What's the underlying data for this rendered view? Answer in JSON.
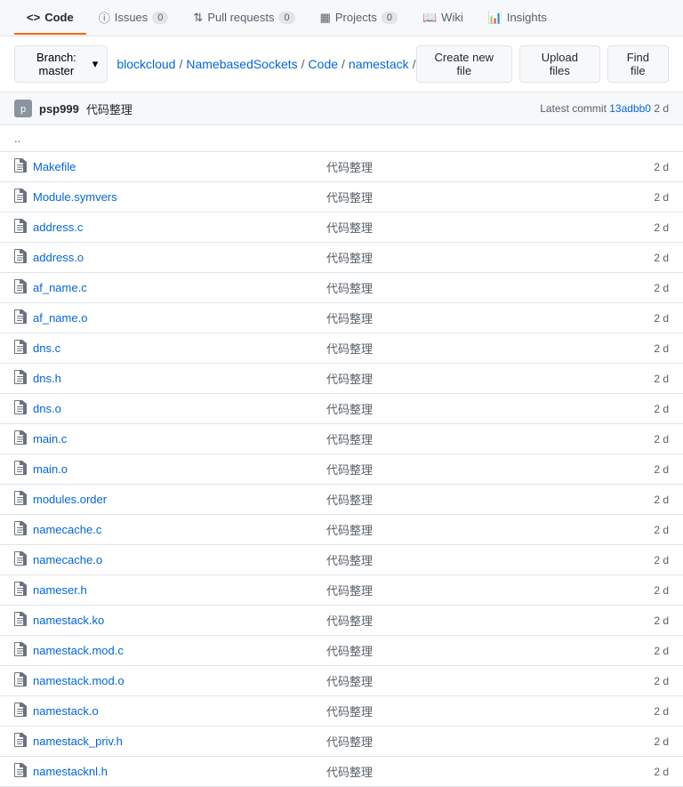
{
  "nav": {
    "tabs": [
      {
        "id": "code",
        "label": "Code",
        "icon": "<>",
        "badge": null,
        "active": true
      },
      {
        "id": "issues",
        "label": "Issues",
        "icon": "!",
        "badge": "0",
        "active": false
      },
      {
        "id": "pull-requests",
        "label": "Pull requests",
        "icon": "↕",
        "badge": "0",
        "active": false
      },
      {
        "id": "projects",
        "label": "Projects",
        "icon": "▦",
        "badge": "0",
        "active": false
      },
      {
        "id": "wiki",
        "label": "Wiki",
        "icon": "📖",
        "badge": null,
        "active": false
      },
      {
        "id": "insights",
        "label": "Insights",
        "icon": "📊",
        "badge": null,
        "active": false
      }
    ]
  },
  "toolbar": {
    "branch_label": "Branch: master",
    "branch_caret": "▾",
    "breadcrumb": [
      {
        "text": "blockcloud",
        "href": "#"
      },
      {
        "sep": "/"
      },
      {
        "text": "NamebasedSockets",
        "href": "#"
      },
      {
        "sep": "/"
      },
      {
        "text": "Code",
        "href": "#"
      },
      {
        "sep": "/"
      },
      {
        "text": "namestack",
        "href": "#"
      },
      {
        "sep": "/"
      }
    ],
    "buttons": [
      {
        "id": "create-new-file",
        "label": "Create new file"
      },
      {
        "id": "upload-files",
        "label": "Upload files"
      },
      {
        "id": "find-file",
        "label": "Find file"
      }
    ]
  },
  "commit_header": {
    "avatar_text": "p",
    "username": "psp999",
    "commit_message": "代码整理",
    "latest_commit_label": "Latest commit",
    "commit_hash": "13adbb0",
    "commit_time": "2 d"
  },
  "files": [
    {
      "name": "..",
      "type": "parent",
      "message": "",
      "time": ""
    },
    {
      "name": "Makefile",
      "type": "file",
      "message": "代码整理",
      "time": "2 d"
    },
    {
      "name": "Module.symvers",
      "type": "file",
      "message": "代码整理",
      "time": "2 d"
    },
    {
      "name": "address.c",
      "type": "file",
      "message": "代码整理",
      "time": "2 d"
    },
    {
      "name": "address.o",
      "type": "file",
      "message": "代码整理",
      "time": "2 d"
    },
    {
      "name": "af_name.c",
      "type": "file",
      "message": "代码整理",
      "time": "2 d"
    },
    {
      "name": "af_name.o",
      "type": "file",
      "message": "代码整理",
      "time": "2 d"
    },
    {
      "name": "dns.c",
      "type": "file",
      "message": "代码整理",
      "time": "2 d"
    },
    {
      "name": "dns.h",
      "type": "file",
      "message": "代码整理",
      "time": "2 d"
    },
    {
      "name": "dns.o",
      "type": "file",
      "message": "代码整理",
      "time": "2 d"
    },
    {
      "name": "main.c",
      "type": "file",
      "message": "代码整理",
      "time": "2 d"
    },
    {
      "name": "main.o",
      "type": "file",
      "message": "代码整理",
      "time": "2 d"
    },
    {
      "name": "modules.order",
      "type": "file",
      "message": "代码整理",
      "time": "2 d"
    },
    {
      "name": "namecache.c",
      "type": "file",
      "message": "代码整理",
      "time": "2 d"
    },
    {
      "name": "namecache.o",
      "type": "file",
      "message": "代码整理",
      "time": "2 d"
    },
    {
      "name": "nameser.h",
      "type": "file",
      "message": "代码整理",
      "time": "2 d"
    },
    {
      "name": "namestack.ko",
      "type": "file",
      "message": "代码整理",
      "time": "2 d"
    },
    {
      "name": "namestack.mod.c",
      "type": "file",
      "message": "代码整理",
      "time": "2 d"
    },
    {
      "name": "namestack.mod.o",
      "type": "file",
      "message": "代码整理",
      "time": "2 d"
    },
    {
      "name": "namestack.o",
      "type": "file",
      "message": "代码整理",
      "time": "2 d"
    },
    {
      "name": "namestack_priv.h",
      "type": "file",
      "message": "代码整理",
      "time": "2 d"
    },
    {
      "name": "namestacknl.h",
      "type": "file",
      "message": "代码整理",
      "time": "2 d"
    }
  ]
}
